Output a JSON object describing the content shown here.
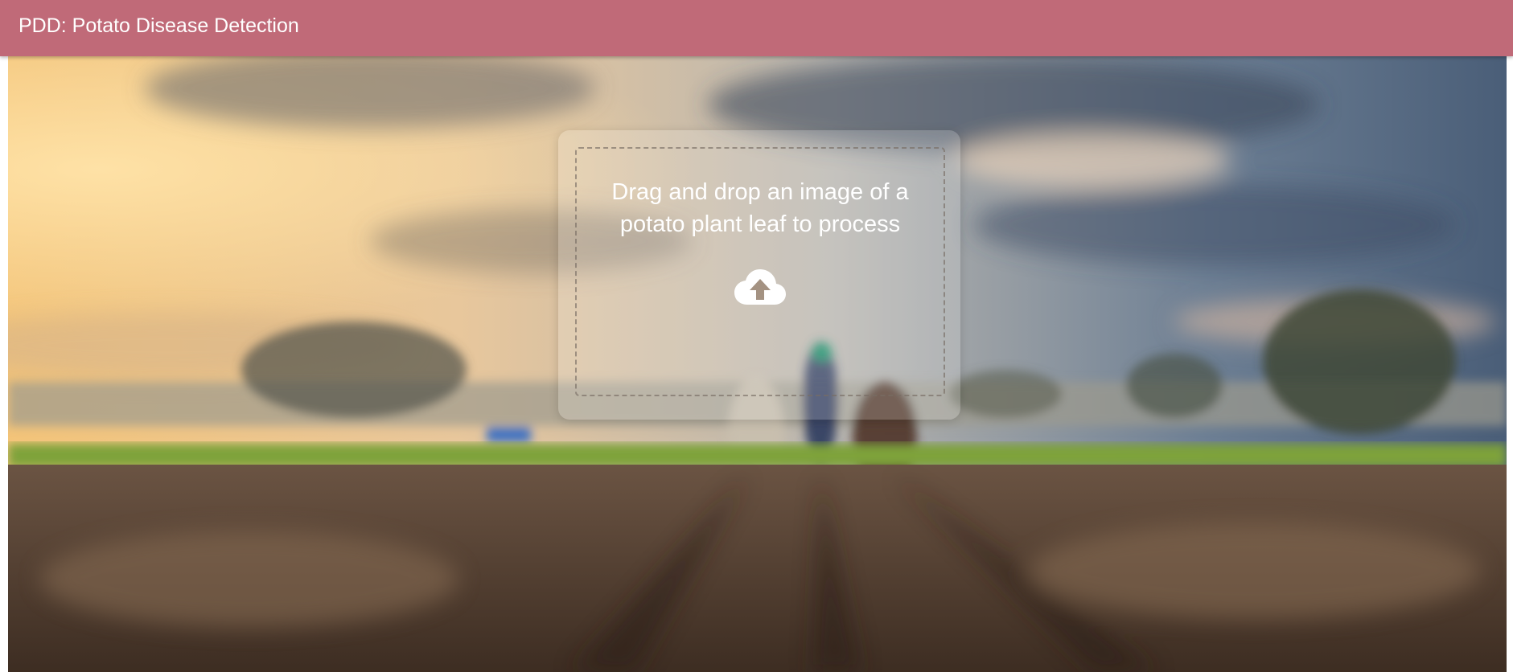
{
  "app_bar": {
    "title": "PDD: Potato Disease Detection",
    "color": "#c06a78"
  },
  "dropzone": {
    "instruction": "Drag and drop an image of a potato plant leaf to process",
    "icon": "cloud-upload-icon"
  }
}
